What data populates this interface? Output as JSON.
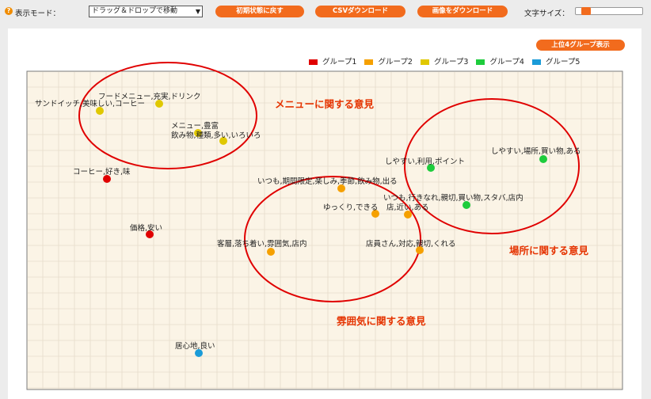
{
  "toolbar": {
    "help_icon": "?",
    "mode_label": "表示モード：",
    "mode_select_value": "ドラッグ＆ドロップで移動",
    "reset_button": "初期状態に戻す",
    "csv_button": "CSVダウンロード",
    "image_button": "画像をダウンロード",
    "font_size_label": "文字サイズ：",
    "font_size_level": 0.1
  },
  "top4_button": "上位4グループ表示",
  "colors": {
    "accent": "#f26b1d",
    "plot_bg": "#fbf4e6",
    "grid": "#e6dccb",
    "circle": "#e00000",
    "annotation": "#e53300"
  },
  "legend": [
    {
      "label": "グループ1",
      "color": "#e00000"
    },
    {
      "label": "グループ2",
      "color": "#f5a000"
    },
    {
      "label": "グループ3",
      "color": "#e0c800"
    },
    {
      "label": "グループ4",
      "color": "#1ecc3c"
    },
    {
      "label": "グループ5",
      "color": "#1a9bd8"
    }
  ],
  "annotations": [
    "メニューに関する意見",
    "場所に関する意見",
    "雰囲気に関する意見"
  ],
  "words": [
    {
      "text": "フードメニュー,充実,ドリンク",
      "group": 3
    },
    {
      "text": "サンドイッチ,美味しい,コーヒー",
      "group": 3
    },
    {
      "text": "メニュー,豊富",
      "group": 3
    },
    {
      "text": "飲み物,種類,多い,いろいろ",
      "group": 3
    },
    {
      "text": "コーヒー,好き,味",
      "group": 1
    },
    {
      "text": "価格,安い",
      "group": 1
    },
    {
      "text": "いつも,期間限定,楽しみ,季節,飲み物,出る",
      "group": 2
    },
    {
      "text": "ゆっくり,できる",
      "group": 2
    },
    {
      "text": "店,近い,ある",
      "group": 2
    },
    {
      "text": "客層,落ち着い,雰囲気,店内",
      "group": 2
    },
    {
      "text": "店員さん,対応,親切,くれる",
      "group": 2
    },
    {
      "text": "しやすい,利用,ポイント",
      "group": 4
    },
    {
      "text": "しやすい,場所,買い物,ある",
      "group": 4
    },
    {
      "text": "いつも,行きなれ,親切,買い物,スタバ,店内",
      "group": 4
    },
    {
      "text": "居心地,良い",
      "group": 5
    }
  ]
}
